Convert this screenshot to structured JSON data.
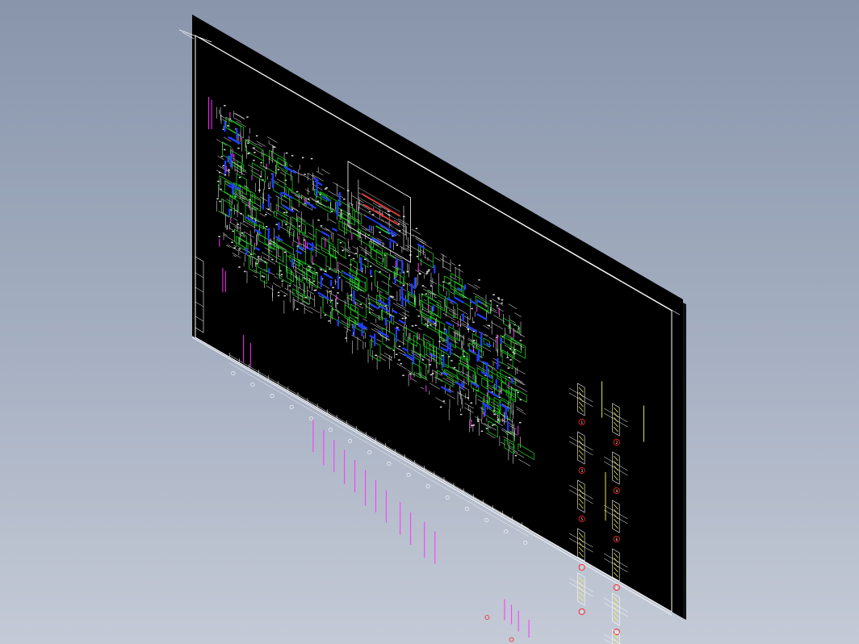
{
  "viewport": {
    "background_top": "#8895ab",
    "background_bottom": "#c4cad6"
  },
  "sheet": {
    "paper_color": "#000000",
    "frame_color": "#ffffff",
    "main_plan_title": "",
    "detail_marks": [
      "1",
      "2",
      "3",
      "4",
      "5",
      "6",
      "7",
      "8",
      "9",
      "10",
      "11"
    ]
  },
  "colors": {
    "walls": "#ffffff",
    "beams": "#1f3cff",
    "slabs": "#22dd22",
    "columns": "#ff33ff",
    "hatch": "#ffff44",
    "marks": "#ff2222"
  },
  "layers_visible": [
    "white",
    "blue",
    "green",
    "magenta",
    "yellow",
    "red"
  ]
}
